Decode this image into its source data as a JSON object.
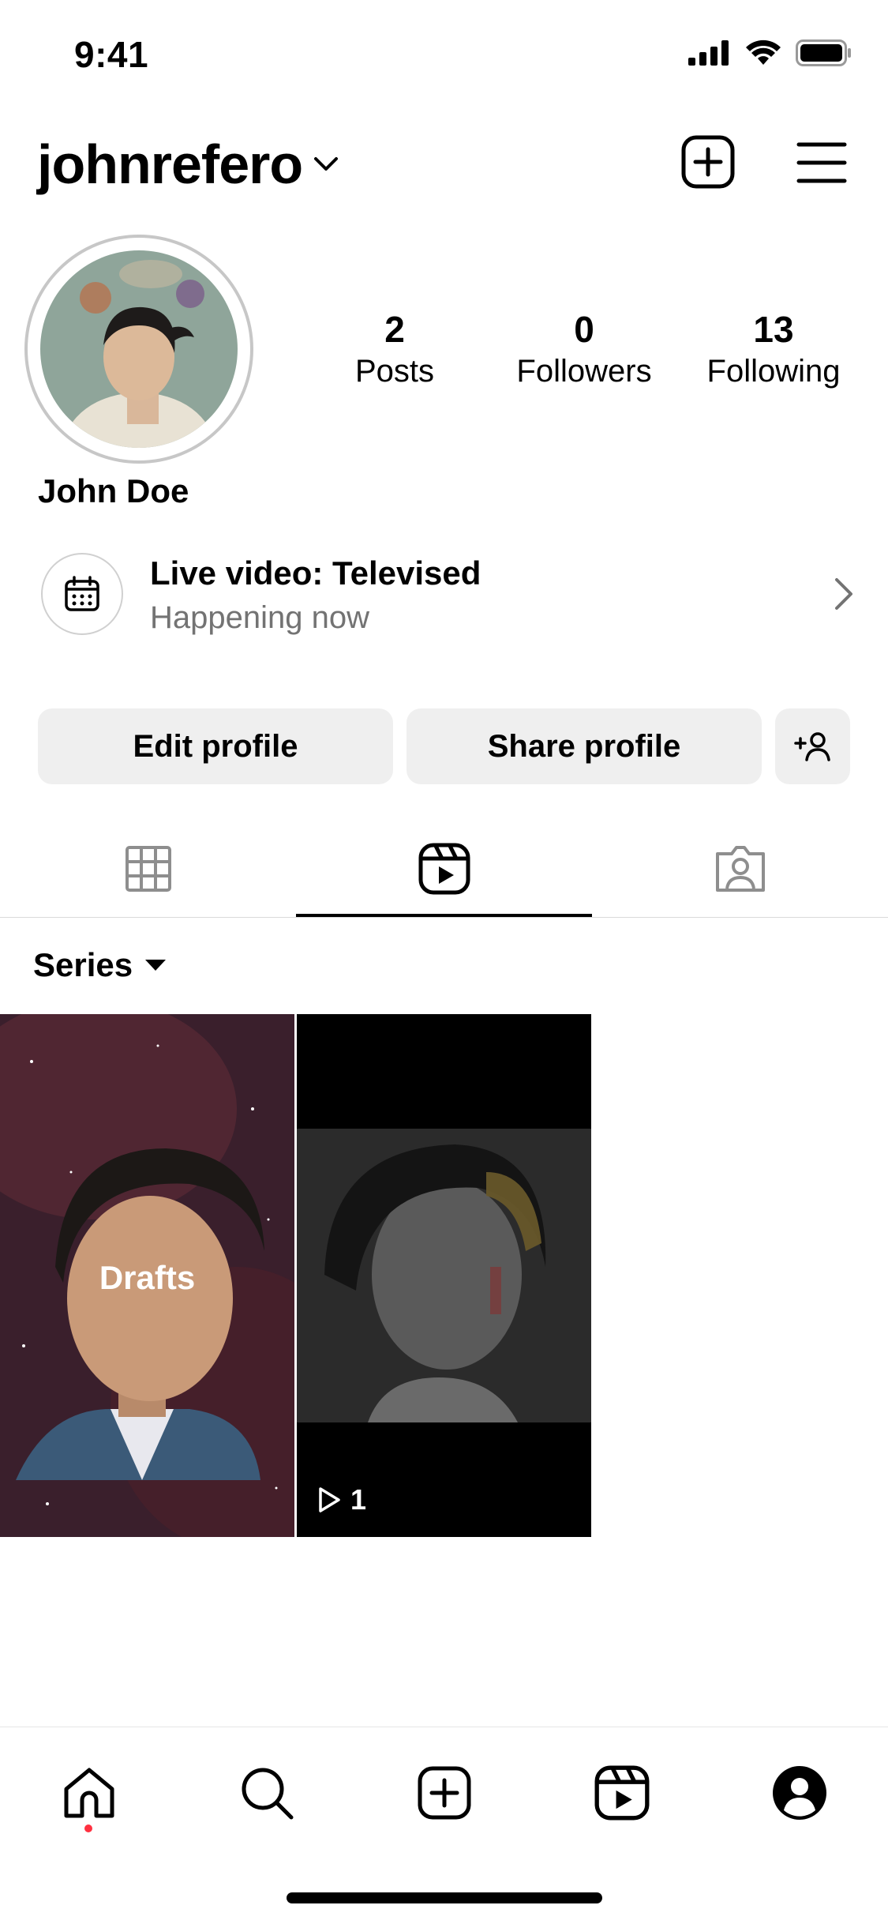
{
  "status_bar": {
    "time": "9:41"
  },
  "header": {
    "username": "johnrefero"
  },
  "profile": {
    "display_name": "John Doe",
    "stats": [
      {
        "value": "2",
        "label": "Posts"
      },
      {
        "value": "0",
        "label": "Followers"
      },
      {
        "value": "13",
        "label": "Following"
      }
    ]
  },
  "live_event": {
    "title": "Live video: Televised",
    "subtitle": "Happening now"
  },
  "actions": {
    "edit_label": "Edit profile",
    "share_label": "Share profile"
  },
  "tabs": [
    {
      "icon": "grid-icon",
      "active": false
    },
    {
      "icon": "reels-icon",
      "active": true
    },
    {
      "icon": "tagged-icon",
      "active": false
    }
  ],
  "filter": {
    "label": "Series"
  },
  "tiles": [
    {
      "label": "Drafts"
    },
    {
      "play_count": "1"
    }
  ],
  "bottom_nav": [
    "home-icon",
    "search-icon",
    "create-icon",
    "reels-icon",
    "profile-icon"
  ],
  "colors": {
    "accent_dot": "#ff3040",
    "button_bg": "#efefef",
    "secondary_text": "#737373"
  }
}
